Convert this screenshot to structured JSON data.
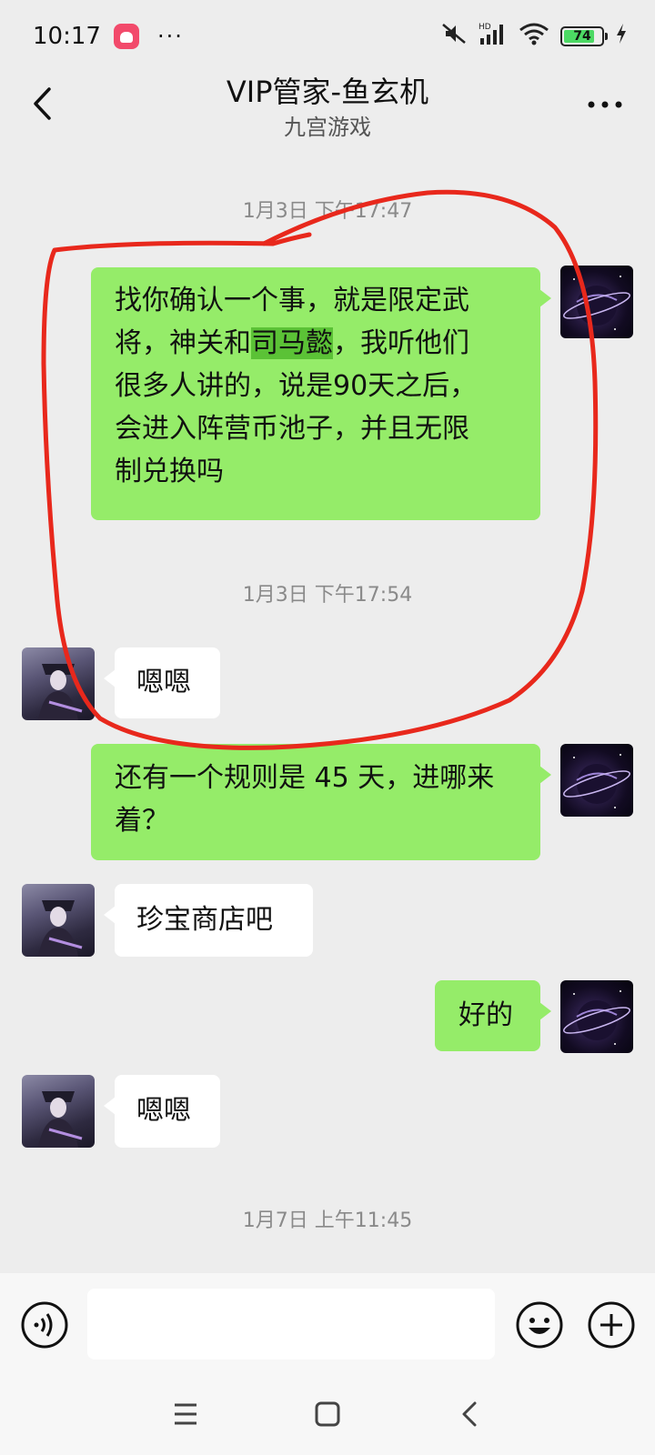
{
  "status_bar": {
    "time": "10:17",
    "dots": "···",
    "network": "HD",
    "battery": "74",
    "battery_percent": 74
  },
  "header": {
    "title": "VIP管家-鱼玄机",
    "subtitle": "九宫游戏"
  },
  "messages": {
    "ts1": "1月3日 下午17:47",
    "m1_pre": "找你确认一个事，就是限定武",
    "m1_l2a": "将，神关和",
    "m1_hl": "司马懿",
    "m1_l2b": "，我听他们",
    "m1_l3": "很多人讲的，说是90天之后，",
    "m1_l4": "会进入阵营币池子，并且无限",
    "m1_l5": "制兑换吗",
    "ts2": "1月3日 下午17:54",
    "m2": "嗯嗯",
    "m3_l1": "还有一个规则是 45 天，进哪来",
    "m3_l2": "着？",
    "m4": "珍宝商店吧",
    "m5": "好的",
    "m6": "嗯嗯",
    "ts3": "1月7日 上午11:45"
  },
  "colors": {
    "background": "#ededed",
    "bubble_self": "#95ec69",
    "bubble_other": "#ffffff",
    "annotation_red": "#e8281c"
  },
  "icons": [
    "back-arrow-icon",
    "more-icon",
    "voice-icon",
    "emoji-icon",
    "plus-icon",
    "menu-icon",
    "home-icon",
    "back-nav-icon"
  ]
}
